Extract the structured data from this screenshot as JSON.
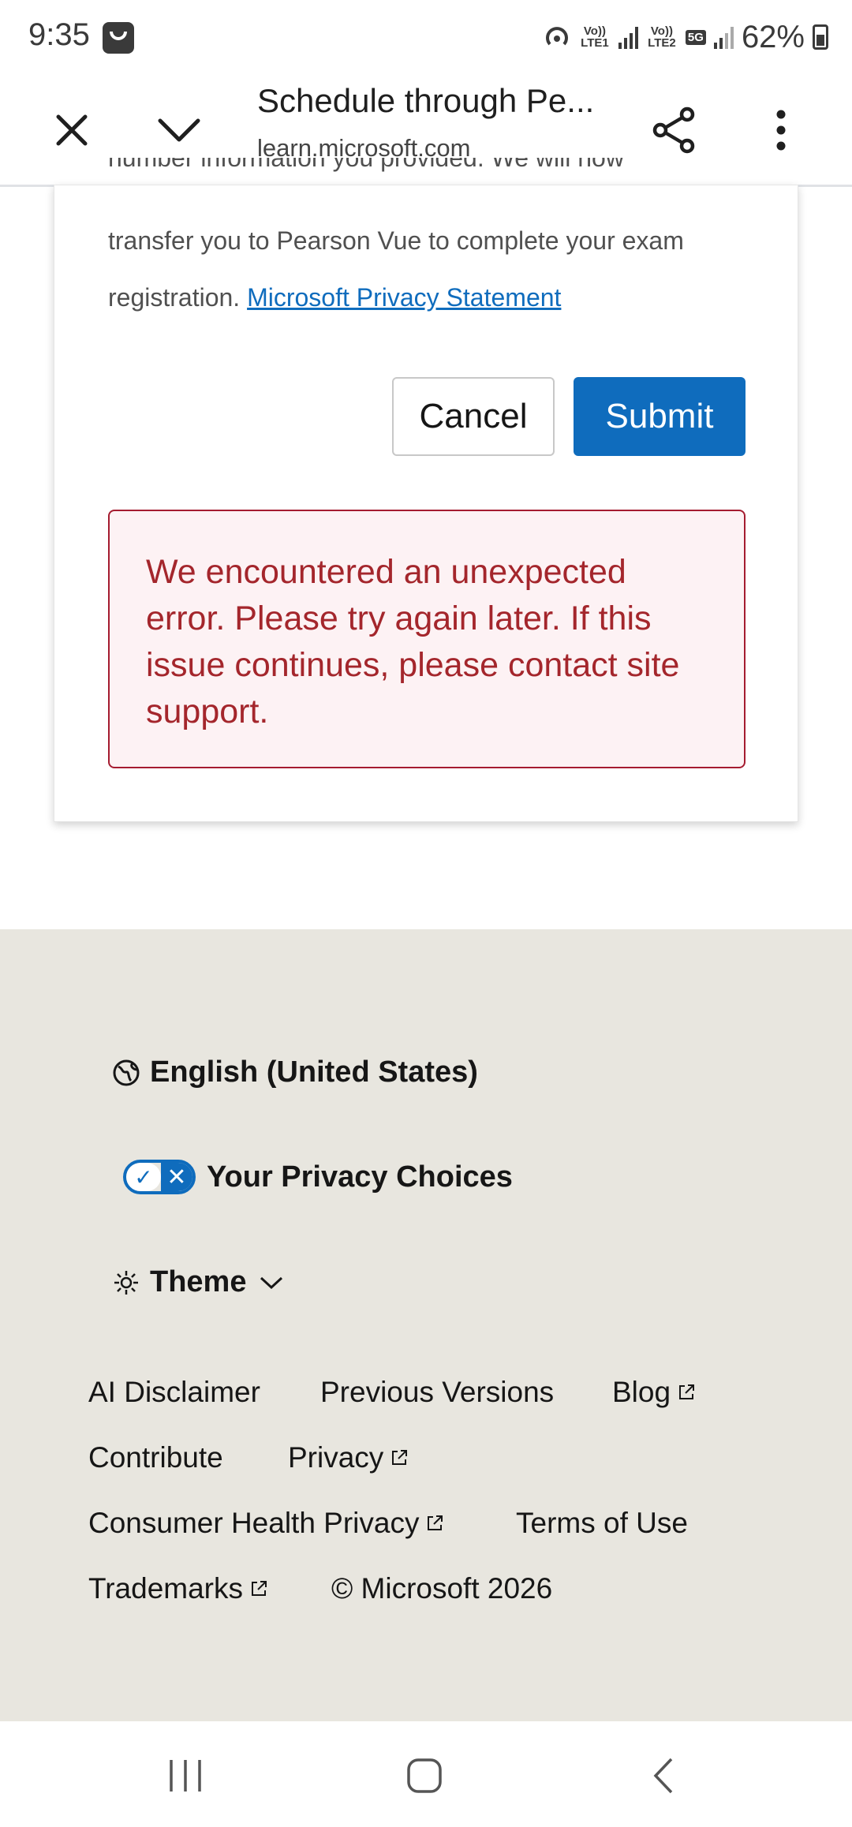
{
  "status_bar": {
    "time": "9:35",
    "net1": "Vo)) LTE1",
    "net2": "Vo)) LTE2",
    "net_type": "5G",
    "battery": "62%"
  },
  "toolbar": {
    "title": "Schedule through Pe...",
    "url": "learn.microsoft.com"
  },
  "card": {
    "partial_line": "number information you provided. We will now",
    "text": "transfer you to Pearson Vue to complete your exam registration.",
    "privacy_link": "Microsoft Privacy Statement",
    "cancel_label": "Cancel",
    "submit_label": "Submit",
    "error_message": "We encountered an unexpected error. Please try again later. If this issue continues, please contact site support."
  },
  "footer": {
    "language": "English (United States)",
    "privacy_choices": "Your Privacy Choices",
    "theme": "Theme",
    "links": {
      "ai_disclaimer": "AI Disclaimer",
      "previous_versions": "Previous Versions",
      "blog": "Blog",
      "contribute": "Contribute",
      "privacy": "Privacy",
      "consumer_health_privacy": "Consumer Health Privacy",
      "terms_of_use": "Terms of Use",
      "trademarks": "Trademarks",
      "copyright": "© Microsoft 2026"
    }
  },
  "colors": {
    "accent": "#0f6cbd",
    "error_text": "#a4262c",
    "error_bg": "#fdf2f4",
    "footer_bg": "#e8e6df"
  }
}
